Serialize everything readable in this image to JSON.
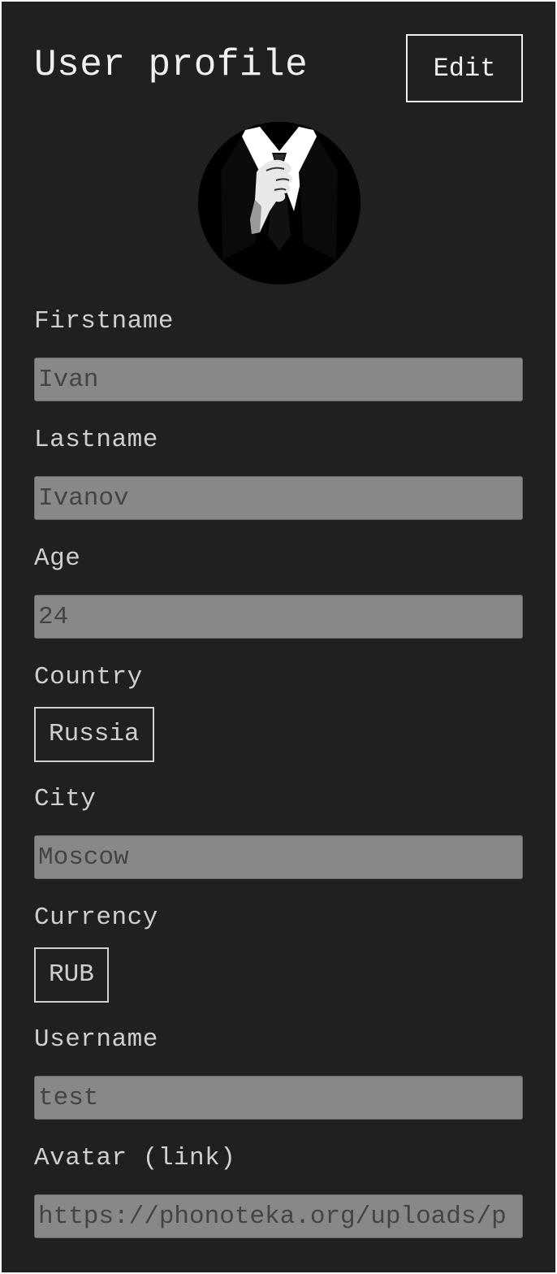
{
  "header": {
    "title": "User profile",
    "edit_label": "Edit"
  },
  "avatar": {
    "icon": "suited-man-avatar"
  },
  "fields": {
    "firstname": {
      "label": "Firstname",
      "value": "Ivan"
    },
    "lastname": {
      "label": "Lastname",
      "value": "Ivanov"
    },
    "age": {
      "label": "Age",
      "value": "24"
    },
    "country": {
      "label": "Country",
      "value": "Russia"
    },
    "city": {
      "label": "City",
      "value": "Moscow"
    },
    "currency": {
      "label": "Currency",
      "value": "RUB"
    },
    "username": {
      "label": "Username",
      "value": "test"
    },
    "avatar_link": {
      "label": "Avatar (link)",
      "value": "https://phonoteka.org/uploads/p"
    }
  },
  "colors": {
    "background": "#202020",
    "text": "#f0f0f0",
    "label": "#cfcfcf",
    "input_bg": "#888888",
    "input_text": "#444444"
  }
}
